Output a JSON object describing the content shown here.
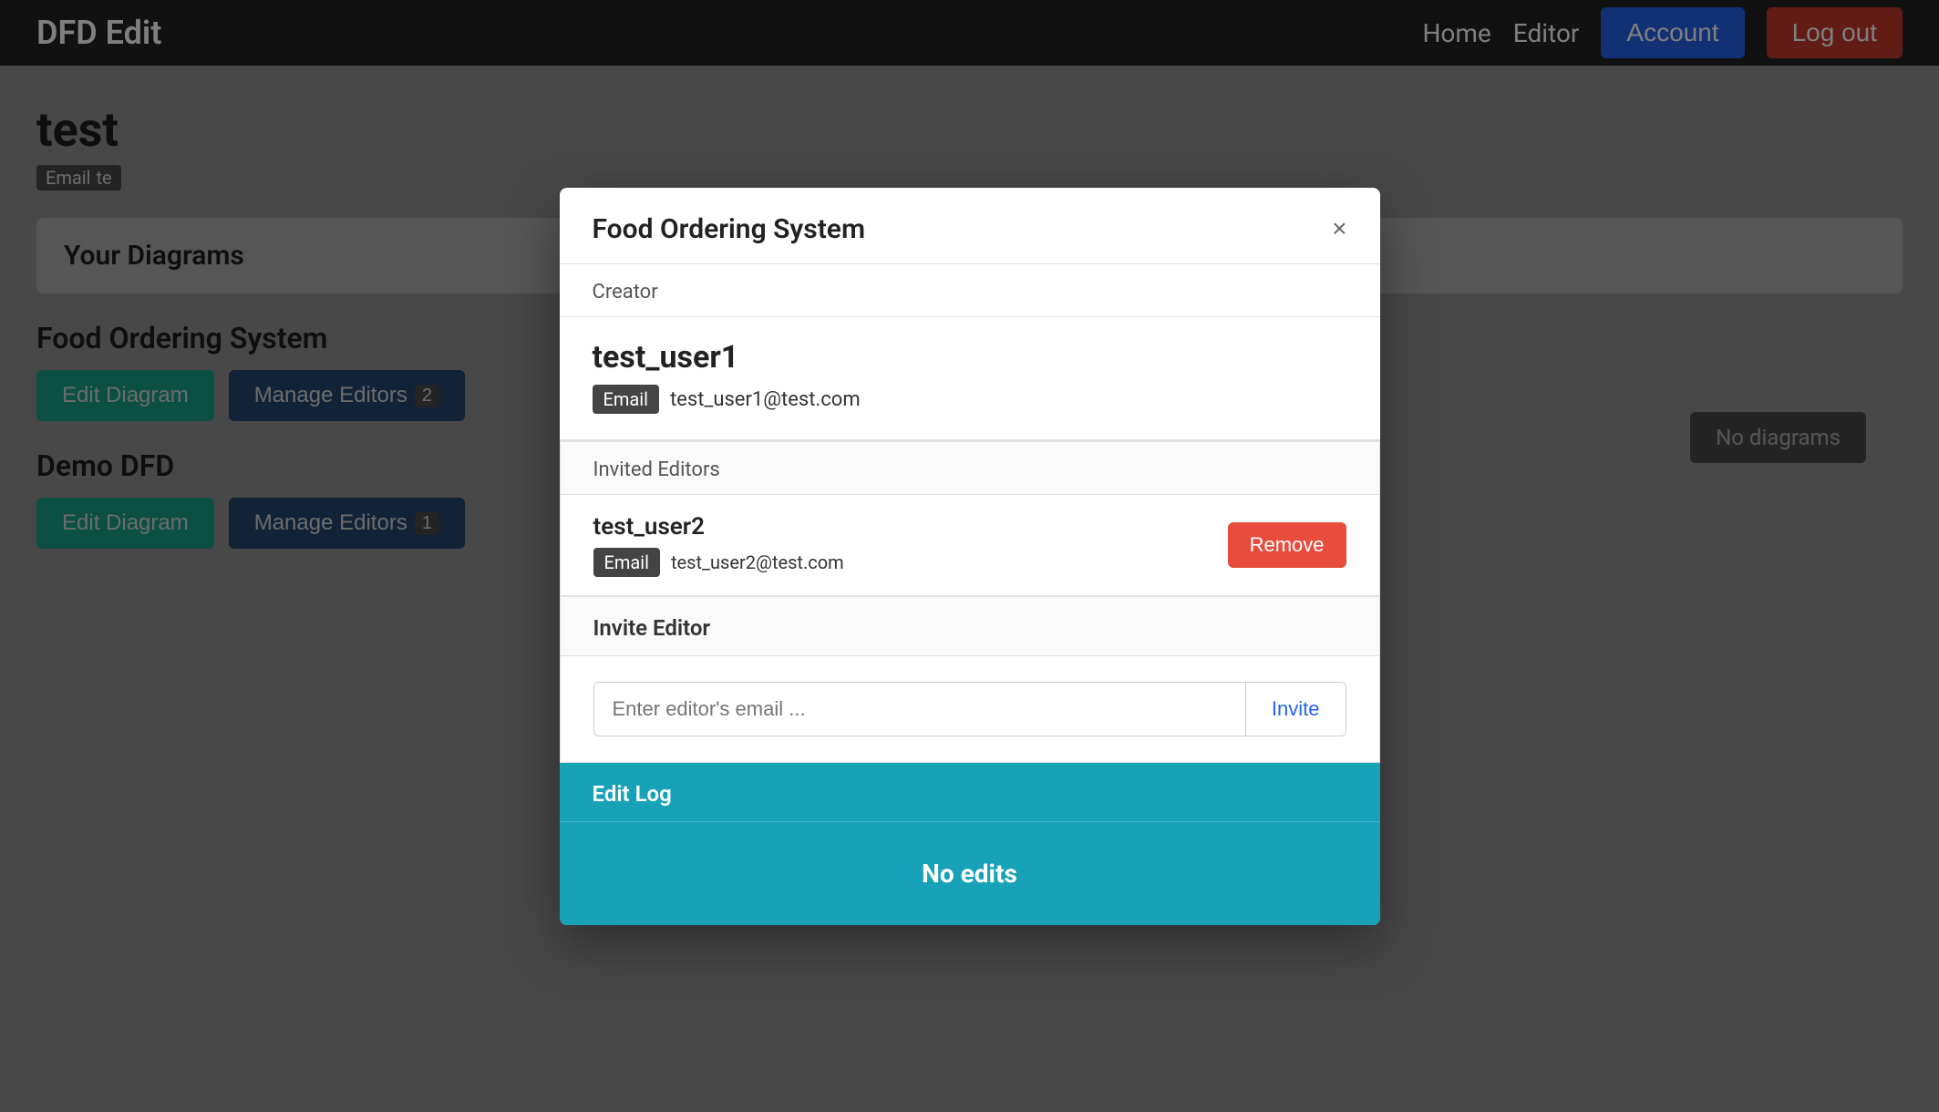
{
  "navbar": {
    "brand": "DFD Edit",
    "links": [
      "Home",
      "Editor"
    ],
    "account_label": "Account",
    "logout_label": "Log out"
  },
  "background": {
    "page_title": "test",
    "email_badge_label": "Email",
    "email_value": "te",
    "your_diagrams_label": "Your Diagrams",
    "diagrams": [
      {
        "name": "Food Ordering System",
        "edit_btn": "Edit Diagram",
        "manage_btn": "Manage Editors",
        "editor_count": "2"
      },
      {
        "name": "Demo DFD",
        "edit_btn": "Edit Diagram",
        "manage_btn": "Manage Editors",
        "editor_count": "1"
      }
    ],
    "no_diagrams_label": "No diagrams"
  },
  "modal": {
    "title": "Food Ordering System",
    "close_icon": "×",
    "creator_label": "Creator",
    "creator_username": "test_user1",
    "creator_email_badge": "Email",
    "creator_email": "test_user1@test.com",
    "invited_editors_label": "Invited Editors",
    "editors": [
      {
        "username": "test_user2",
        "email_badge": "Email",
        "email": "test_user2@test.com",
        "remove_btn": "Remove"
      }
    ],
    "invite_section_label": "Invite Editor",
    "invite_placeholder": "Enter editor's email ...",
    "invite_btn": "Invite",
    "edit_log_label": "Edit Log",
    "no_edits_label": "No edits"
  }
}
